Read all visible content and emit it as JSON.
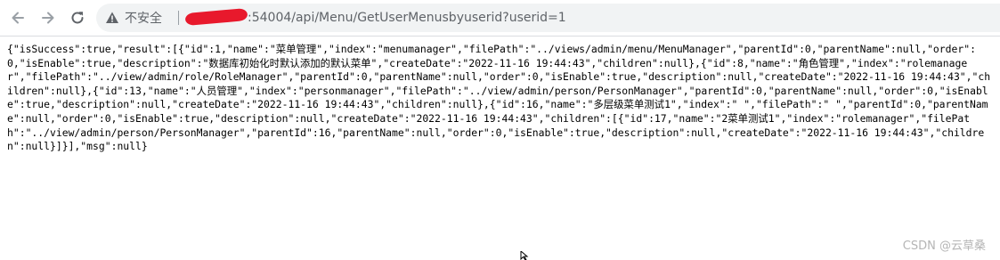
{
  "browser": {
    "security_label": "不安全",
    "url_host_visible": ":54004",
    "url_path": "/api/Menu/GetUserMenusbyuserid?userid=1",
    "icons": [
      "back-arrow-icon",
      "forward-arrow-icon",
      "reload-icon",
      "warning-icon"
    ]
  },
  "response_body": "{\"isSuccess\":true,\"result\":[{\"id\":1,\"name\":\"菜单管理\",\"index\":\"menumanager\",\"filePath\":\"../views/admin/menu/MenuManager\",\"parentId\":0,\"parentName\":null,\"order\":0,\"isEnable\":true,\"description\":\"数据库初始化时默认添加的默认菜单\",\"createDate\":\"2022-11-16 19:44:43\",\"children\":null},{\"id\":8,\"name\":\"角色管理\",\"index\":\"rolemanager\",\"filePath\":\"../view/admin/role/RoleManager\",\"parentId\":0,\"parentName\":null,\"order\":0,\"isEnable\":true,\"description\":null,\"createDate\":\"2022-11-16 19:44:43\",\"children\":null},{\"id\":13,\"name\":\"人员管理\",\"index\":\"personmanager\",\"filePath\":\"../view/admin/person/PersonManager\",\"parentId\":0,\"parentName\":null,\"order\":0,\"isEnable\":true,\"description\":null,\"createDate\":\"2022-11-16 19:44:43\",\"children\":null},{\"id\":16,\"name\":\"多层级菜单测试1\",\"index\":\" \",\"filePath\":\" \",\"parentId\":0,\"parentName\":null,\"order\":0,\"isEnable\":true,\"description\":null,\"createDate\":\"2022-11-16 19:44:43\",\"children\":[{\"id\":17,\"name\":\"2菜单测试1\",\"index\":\"rolemanager\",\"filePath\":\"../view/admin/person/PersonManager\",\"parentId\":16,\"parentName\":null,\"order\":0,\"isEnable\":true,\"description\":null,\"createDate\":\"2022-11-16 19:44:43\",\"children\":null}]}],\"msg\":null}",
  "watermark": "CSDN @云草桑"
}
